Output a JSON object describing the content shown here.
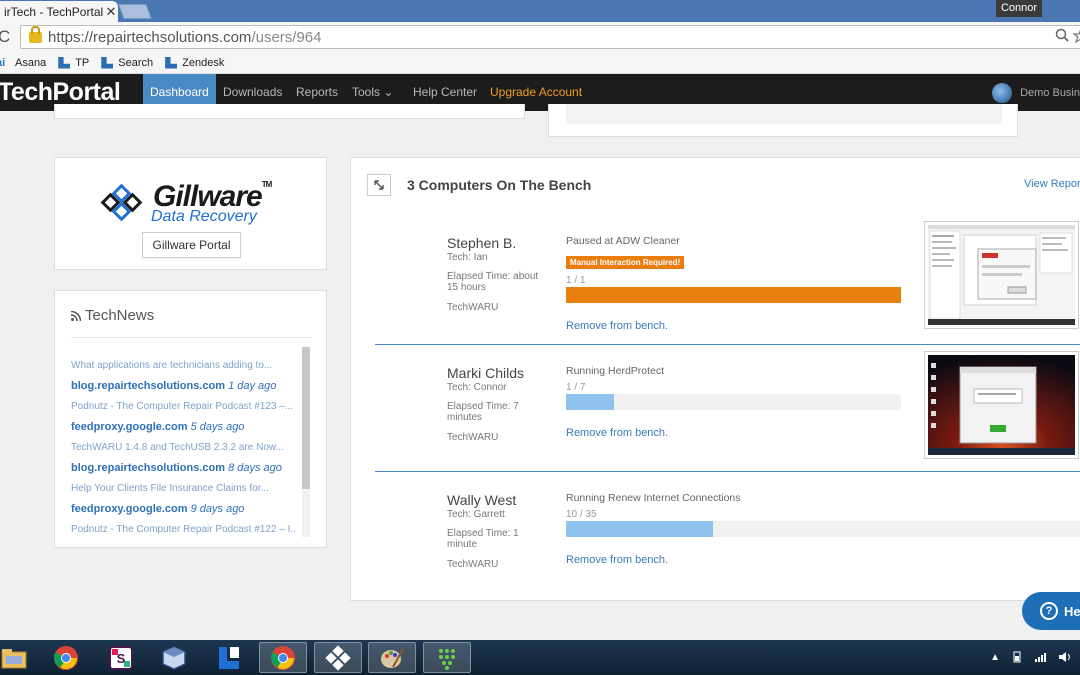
{
  "browser": {
    "tab_title": "irTech - TechPortal",
    "tab_close": "✕",
    "user": "Connor",
    "reload_glyph": "C",
    "url_host": "https://repairtechsolutions.com",
    "url_path": "/users/964",
    "bookmarks": [
      {
        "icon": "asana-icon",
        "prefix": "ai",
        "label": "Asana"
      },
      {
        "icon": "techportal-icon",
        "label": "TP"
      },
      {
        "icon": "techportal-icon",
        "label": "Search"
      },
      {
        "icon": "techportal-icon",
        "label": "Zendesk"
      }
    ]
  },
  "nav": {
    "logo": "TechPortal",
    "items": [
      {
        "label": "Dashboard",
        "active": true
      },
      {
        "label": "Downloads"
      },
      {
        "label": "Reports"
      },
      {
        "label": "Tools ⌄"
      },
      {
        "label": "Help Center"
      },
      {
        "label": "Upgrade Account"
      }
    ],
    "account": "Demo Busin"
  },
  "gillware": {
    "name": "Gillware",
    "tm": "TM",
    "sub": "Data Recovery",
    "button": "Gillware Portal"
  },
  "technews": {
    "title": "TechNews",
    "items": [
      {
        "headline": "What applications are technicians adding to...",
        "source": "blog.repairtechsolutions.com",
        "ago": "1 day ago"
      },
      {
        "headline": "Podnutz - The Computer Repair Podcast #123 –...",
        "source": "feedproxy.google.com",
        "ago": "5 days ago"
      },
      {
        "headline": "TechWARU 1.4.8 and TechUSB 2.3.2 are Now...",
        "source": "blog.repairtechsolutions.com",
        "ago": "8 days ago"
      },
      {
        "headline": "Help Your Clients File Insurance Claims for...",
        "source": "feedproxy.google.com",
        "ago": "9 days ago"
      },
      {
        "headline": "Podnutz - The Computer Repair Podcast #122 – I...",
        "source": "",
        "ago": ""
      }
    ]
  },
  "bench": {
    "title": "3 Computers On The Bench",
    "view_report": "View Report",
    "items": [
      {
        "customer": "Stephen B.",
        "tech": "Tech: Ian",
        "elapsed": "Elapsed Time: about 15 hours",
        "tool": "TechWARU",
        "status": "Paused at ADW Cleaner",
        "badge": "Manual Interaction Required!",
        "progress_text": "1 / 1",
        "progress": 1.0,
        "bar_color": "#e8800f",
        "remove": "Remove from bench."
      },
      {
        "customer": "Marki Childs",
        "tech": "Tech: Connor",
        "elapsed": "Elapsed Time: 7 minutes",
        "tool": "TechWARU",
        "status": "Running HerdProtect",
        "badge": "",
        "progress_text": "1 / 7",
        "progress": 0.143,
        "bar_color": "#8fc2ee",
        "remove": "Remove from bench."
      },
      {
        "customer": "Wally West",
        "tech": "Tech: Garrett",
        "elapsed": "Elapsed Time: 1 minute",
        "tool": "TechWARU",
        "status": "Running Renew Internet Connections",
        "badge": "",
        "progress_text": "10 / 35",
        "progress": 0.286,
        "bar_color": "#8fc2ee",
        "remove": "Remove from bench."
      }
    ]
  },
  "help": {
    "label": "He"
  }
}
